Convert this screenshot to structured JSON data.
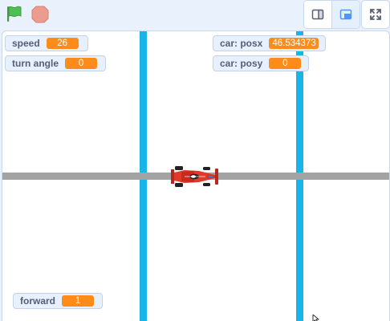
{
  "toolbar": {
    "green_flag_icon": "green-flag-icon",
    "stop_icon": "stop-sign-icon",
    "small_stage_icon": "small-stage-icon",
    "normal_stage_icon": "normal-stage-icon",
    "fullscreen_icon": "fullscreen-icon"
  },
  "monitors": {
    "speed": {
      "label": "speed",
      "value": "26"
    },
    "turn_angle": {
      "label": "turn angle",
      "value": "0"
    },
    "car_posx": {
      "label": "car: posx",
      "value": "46.534373"
    },
    "car_posy": {
      "label": "car: posy",
      "value": "0"
    },
    "forward": {
      "label": "forward",
      "value": "1"
    }
  },
  "colors": {
    "vertical_lines": "#18b5e8",
    "horizontal_line": "#a3a3a3",
    "monitor_value": "#ff8c1a",
    "flag": "#4cbf56",
    "stop": "#ec9c8f"
  },
  "sprite": {
    "icon": "race-car-icon"
  }
}
